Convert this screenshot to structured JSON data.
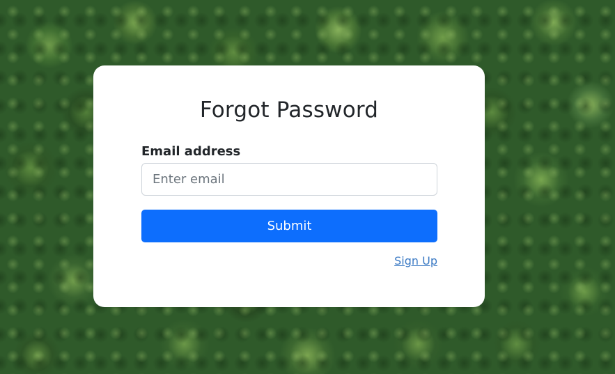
{
  "form": {
    "title": "Forgot Password",
    "email_label": "Email address",
    "email_placeholder": "Enter email",
    "email_value": "",
    "submit_label": "Submit",
    "signup_label": "Sign Up"
  },
  "colors": {
    "primary": "#0d6efd",
    "link": "#3b7ac4",
    "card_background": "#ffffff",
    "text": "#212529"
  }
}
